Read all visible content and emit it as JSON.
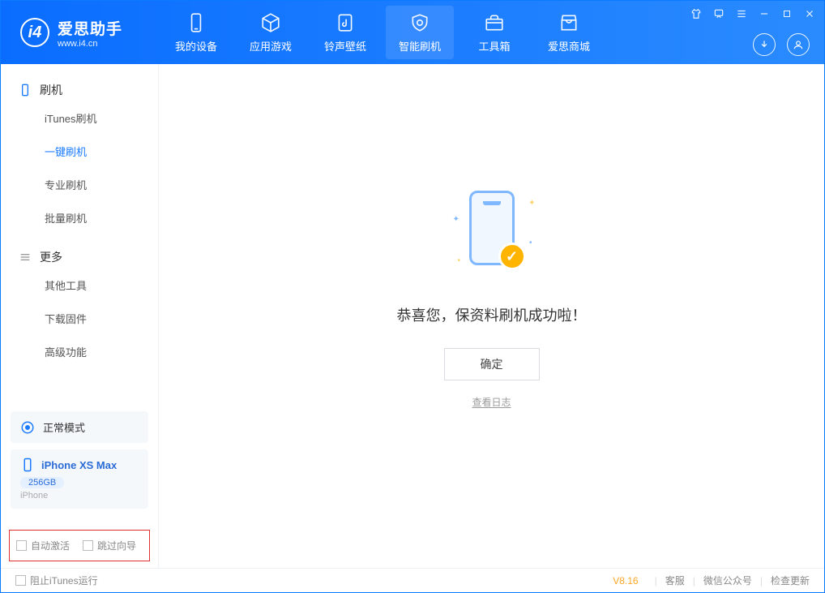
{
  "app": {
    "title": "爱思助手",
    "subtitle": "www.i4.cn"
  },
  "tabs": {
    "device": "我的设备",
    "apps": "应用游戏",
    "ringtones": "铃声壁纸",
    "flash": "智能刷机",
    "toolbox": "工具箱",
    "store": "爱思商城"
  },
  "sidebar": {
    "group_flash": "刷机",
    "items_flash": {
      "itunes": "iTunes刷机",
      "oneclick": "一键刷机",
      "pro": "专业刷机",
      "batch": "批量刷机"
    },
    "group_more": "更多",
    "items_more": {
      "other": "其他工具",
      "firmware": "下载固件",
      "advanced": "高级功能"
    }
  },
  "mode_card": "正常模式",
  "device": {
    "name": "iPhone XS Max",
    "storage": "256GB",
    "type": "iPhone"
  },
  "redbox": {
    "auto_activate": "自动激活",
    "skip_guide": "跳过向导"
  },
  "main": {
    "success": "恭喜您，保资料刷机成功啦！",
    "ok": "确定",
    "view_log": "查看日志"
  },
  "footer": {
    "block_itunes": "阻止iTunes运行",
    "version": "V8.16",
    "support": "客服",
    "wechat": "微信公众号",
    "update": "检查更新"
  }
}
